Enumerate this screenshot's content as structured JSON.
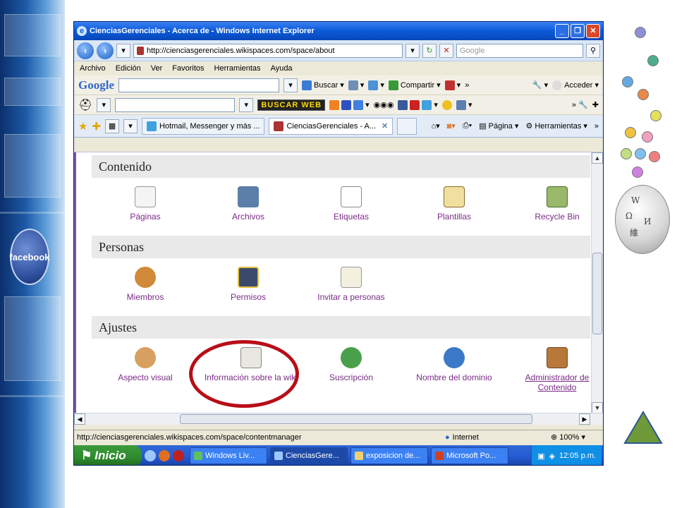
{
  "browser": {
    "title": "CienciasGerenciales - Acerca de - Windows Internet Explorer",
    "address": "http://cienciasgerenciales.wikispaces.com/space/about",
    "search_placeholder": "Google"
  },
  "menu": [
    "Archivo",
    "Edición",
    "Ver",
    "Favoritos",
    "Herramientas",
    "Ayuda"
  ],
  "google_toolbar": {
    "logo": "Google",
    "buscar": "Buscar",
    "compartir": "Compartir",
    "acceder": "Acceder"
  },
  "ask_toolbar": {
    "buscar_web": "BUSCAR WEB"
  },
  "tabs": [
    {
      "label": "Hotmail, Messenger y más ..."
    },
    {
      "label": "CienciasGerenciales - A..."
    }
  ],
  "command_bar": {
    "pagina": "Página",
    "herramientas": "Herramientas"
  },
  "sections": {
    "contenido": {
      "title": "Contenido",
      "items": [
        "Páginas",
        "Archivos",
        "Etiquetas",
        "Plantillas",
        "Recycle Bin"
      ]
    },
    "personas": {
      "title": "Personas",
      "items": [
        "Miembros",
        "Permisos",
        "Invitar a personas"
      ]
    },
    "ajustes": {
      "title": "Ajustes",
      "items": [
        "Aspecto visual",
        "Información sobre la wiki",
        "Suscripción",
        "Nombre del dominio",
        "Administrador de Contenido"
      ]
    }
  },
  "status": {
    "url": "http://cienciasgerenciales.wikispaces.com/space/contentmanager",
    "zone": "Internet",
    "zoom": "100%"
  },
  "taskbar": {
    "start": "Inicio",
    "tasks": [
      "Windows Liv...",
      "CienciasGere...",
      "exposicion de...",
      "Microsoft Po..."
    ],
    "clock": "12:05 p.m."
  },
  "side": {
    "facebook": "facebook"
  },
  "colors": {
    "link_purple": "#7a2b86",
    "highlight_oval": "#b80e17",
    "xp_blue": "#245dd6",
    "start_green": "#2e8b2e"
  }
}
